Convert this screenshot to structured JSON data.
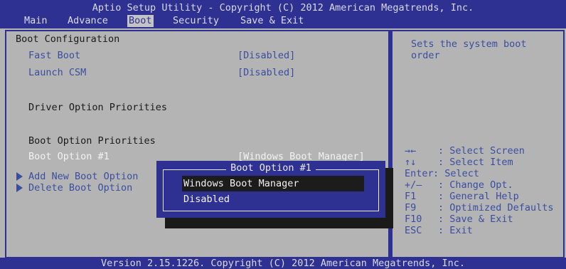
{
  "header": {
    "title": "Aptio Setup Utility - Copyright (C) 2012 American Megatrends, Inc.",
    "tabs": [
      {
        "label": "Main",
        "active": false
      },
      {
        "label": "Advance",
        "active": false
      },
      {
        "label": "Boot",
        "active": true
      },
      {
        "label": "Security",
        "active": false
      },
      {
        "label": "Save & Exit",
        "active": false
      }
    ]
  },
  "main": {
    "boot_config_heading": "Boot Configuration",
    "fast_boot": {
      "label": "Fast Boot",
      "value": "[Disabled]"
    },
    "launch_csm": {
      "label": "Launch CSM",
      "value": "[Disabled]"
    },
    "driver_priorities_heading": "Driver Option Priorities",
    "boot_priorities_heading": "Boot Option Priorities",
    "boot_option_1": {
      "label": "Boot Option #1",
      "value": "[Windows Boot Manager]"
    },
    "add_boot_option": "Add New Boot Option",
    "delete_boot_option": "Delete Boot Option"
  },
  "help": {
    "line1": "Sets the system boot",
    "line2": "order",
    "keys": [
      {
        "key": "→←",
        "desc": ": Select Screen"
      },
      {
        "key": "↑↓",
        "desc": ": Select Item"
      },
      {
        "key": "Enter",
        "desc": ": Select"
      },
      {
        "key": "+/—",
        "desc": ": Change Opt."
      },
      {
        "key": "F1",
        "desc": ": General Help"
      },
      {
        "key": "F9",
        "desc": ": Optimized Defaults"
      },
      {
        "key": "F10",
        "desc": ": Save & Exit"
      },
      {
        "key": "ESC",
        "desc": ": Exit"
      }
    ]
  },
  "popup": {
    "title": "Boot Option #1",
    "options": [
      {
        "label": "Windows Boot Manager",
        "selected": true
      },
      {
        "label": "Disabled",
        "selected": false
      }
    ]
  },
  "footer": {
    "text": "Version 2.15.1226. Copyright (C) 2012 American Megatrends, Inc."
  },
  "colors": {
    "frame_blue": "#2e3192",
    "panel_gray": "#b4b4b4",
    "label_blue": "#3a4ea0"
  }
}
